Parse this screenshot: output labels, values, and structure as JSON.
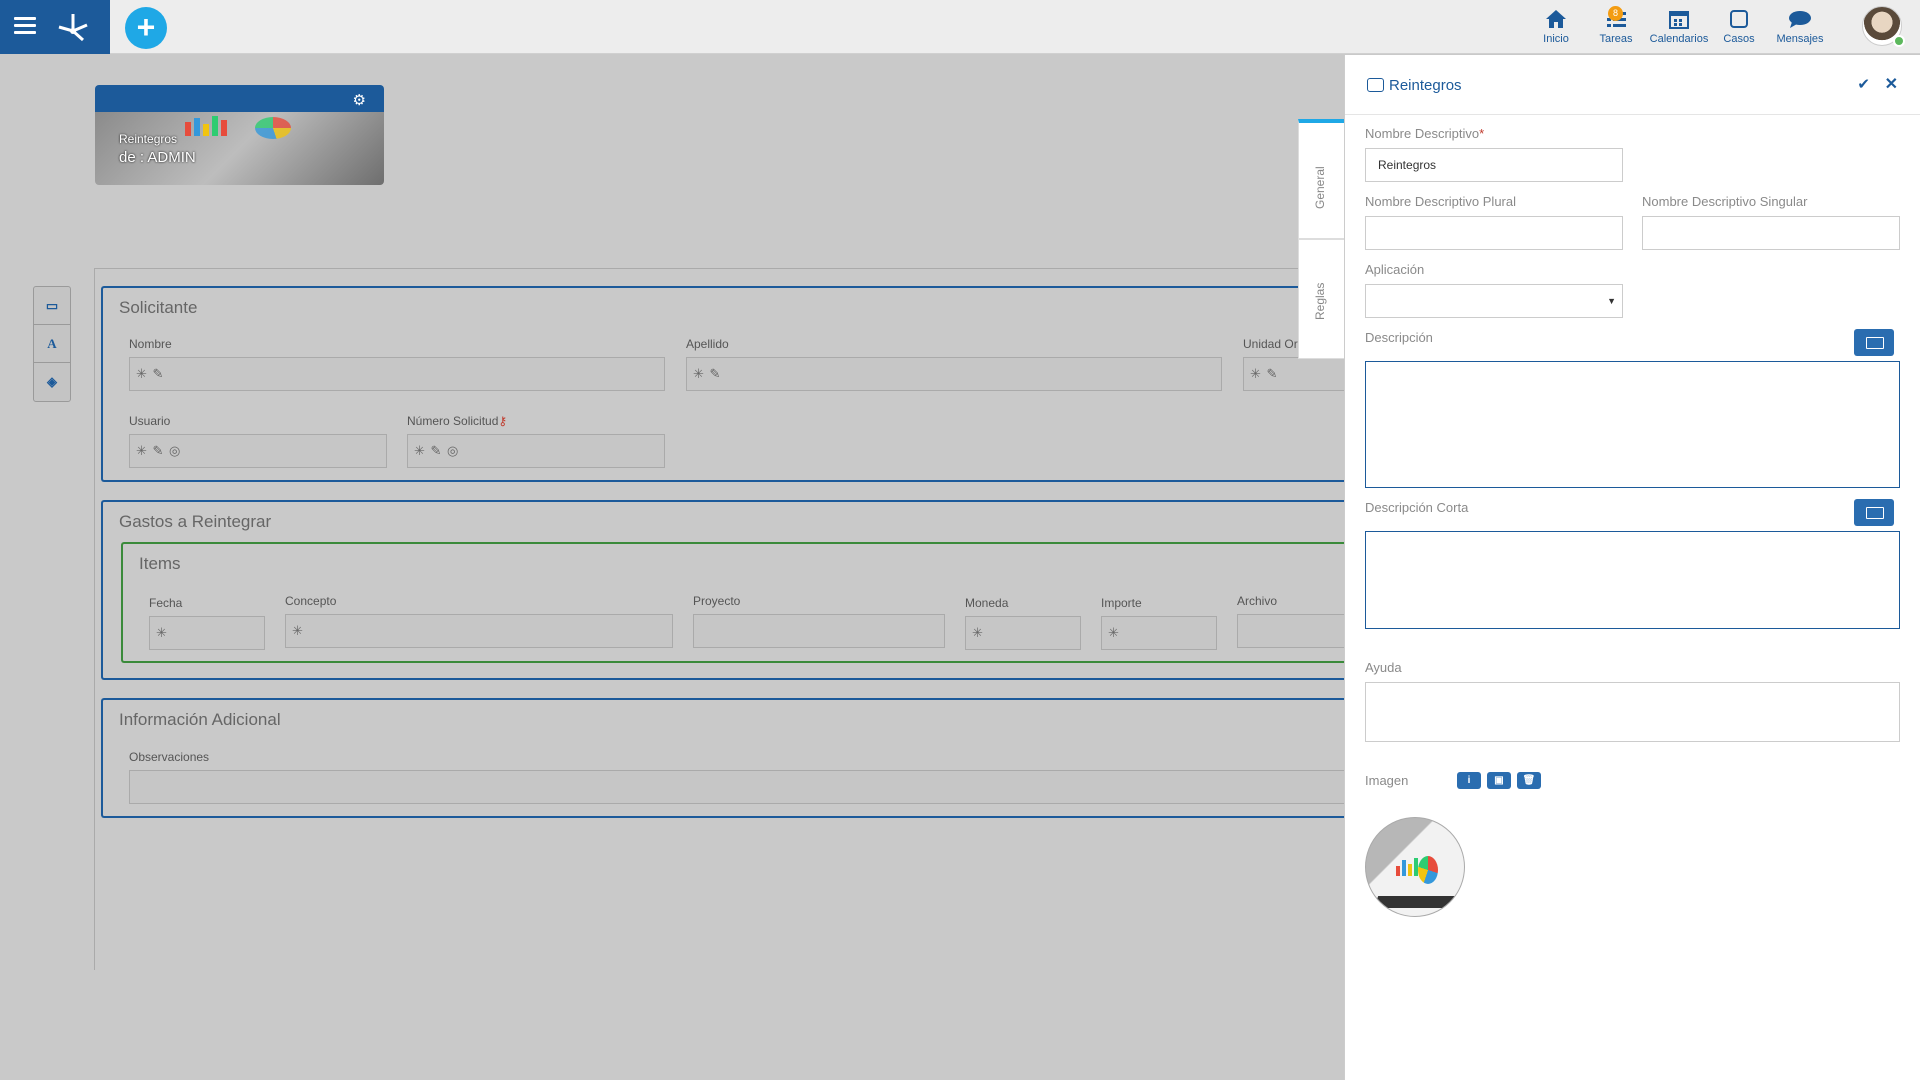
{
  "topbar": {
    "nav": [
      {
        "label": "Inicio",
        "icon": "home-icon"
      },
      {
        "label": "Tareas",
        "icon": "tasks-icon",
        "badge": "8"
      },
      {
        "label": "Calendarios",
        "icon": "calendar-icon"
      },
      {
        "label": "Casos",
        "icon": "cases-icon"
      },
      {
        "label": "Mensajes",
        "icon": "messages-icon"
      }
    ]
  },
  "card": {
    "title": "Reintegros",
    "subtitle": "de : ADMIN"
  },
  "form": {
    "solicitante": {
      "title": "Solicitante",
      "nombre_label": "Nombre",
      "apellido_label": "Apellido",
      "unidad_label": "Unidad Or",
      "usuario_label": "Usuario",
      "numero_label": "Número Solicitud"
    },
    "gastos": {
      "title": "Gastos a Reintegrar",
      "items_title": "Items",
      "fecha_label": "Fecha",
      "concepto_label": "Concepto",
      "proyecto_label": "Proyecto",
      "moneda_label": "Moneda",
      "importe_label": "Importe",
      "archivo_label": "Archivo"
    },
    "info": {
      "title": "Información Adicional",
      "observaciones_label": "Observaciones"
    }
  },
  "panel": {
    "title": "Reintegros",
    "tabs": [
      "General",
      "Reglas"
    ],
    "nombre_descriptivo_label": "Nombre Descriptivo",
    "required_mark": "*",
    "nombre_descriptivo_value": "Reintegros",
    "plural_label": "Nombre Descriptivo Plural",
    "singular_label": "Nombre Descriptivo Singular",
    "aplicacion_label": "Aplicación",
    "descripcion_label": "Descripción",
    "descripcion_corta_label": "Descripción Corta",
    "ayuda_label": "Ayuda",
    "imagen_label": "Imagen"
  },
  "colors": {
    "brand": "#1c5a9a",
    "accent": "#1fa8e6",
    "items_border": "#3a8a3a"
  }
}
